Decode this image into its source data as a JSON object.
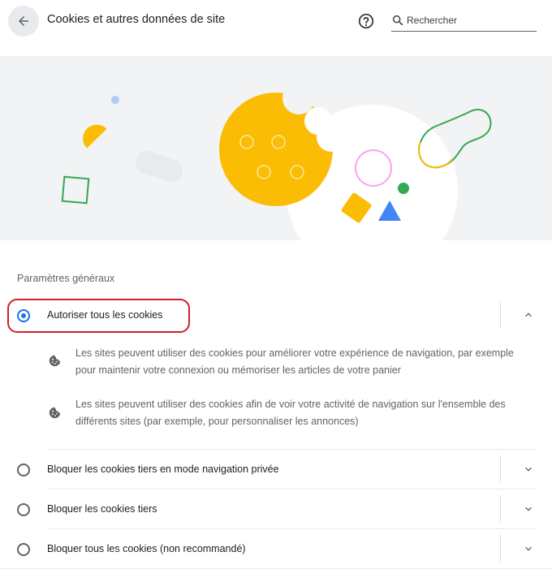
{
  "header": {
    "title": "Cookies et autres données de site",
    "search_placeholder": "Rechercher"
  },
  "section": {
    "title": "Paramètres généraux"
  },
  "options": [
    {
      "label": "Autoriser tous les cookies",
      "selected": true,
      "expanded": true,
      "details": [
        "Les sites peuvent utiliser des cookies pour améliorer votre expérience de navigation, par exemple pour maintenir votre connexion ou mémoriser les articles de votre panier",
        "Les sites peuvent utiliser des cookies afin de voir votre activité de navigation sur l'ensemble des différents sites (par exemple, pour personnaliser les annonces)"
      ]
    },
    {
      "label": "Bloquer les cookies tiers en mode navigation privée",
      "selected": false,
      "expanded": false
    },
    {
      "label": "Bloquer les cookies tiers",
      "selected": false,
      "expanded": false
    },
    {
      "label": "Bloquer tous les cookies (non recommandé)",
      "selected": false,
      "expanded": false
    }
  ],
  "colors": {
    "accent": "#1a73e8",
    "highlight": "#d21f26",
    "cookie": "#fbbc04",
    "green": "#34a853",
    "blue": "#4285f4",
    "pink": "#f5a6f0"
  },
  "icons": {
    "back": "arrow-left-icon",
    "help": "help-circle-icon",
    "search": "search-icon",
    "detail": "cookie-icon",
    "expand": "chevron-down-icon",
    "collapse": "chevron-up-icon"
  }
}
